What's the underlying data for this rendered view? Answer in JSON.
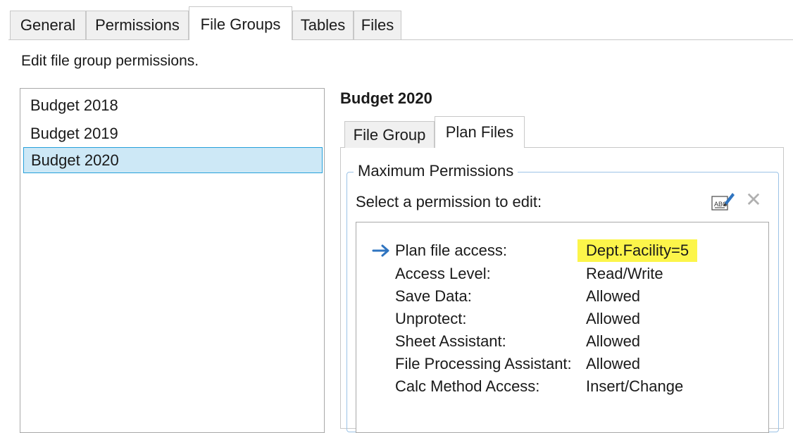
{
  "top_tabs": [
    "General",
    "Permissions",
    "File Groups",
    "Tables",
    "Files"
  ],
  "active_top_tab": "File Groups",
  "caption": "Edit file group permissions.",
  "file_groups": [
    "Budget 2018",
    "Budget 2019",
    "Budget 2020"
  ],
  "selected_group": "Budget 2020",
  "detail": {
    "title": "Budget 2020",
    "tabs": [
      "File Group",
      "Plan Files"
    ],
    "active_tab": "Plan Files",
    "legend": "Maximum Permissions",
    "select_label": "Select a permission to edit:",
    "icons": {
      "edit": "edit-text-icon",
      "clear": "close-icon"
    }
  },
  "permissions": [
    {
      "label": "Plan file access:",
      "value": "Dept.Facility=5",
      "selected": true
    },
    {
      "label": "Access Level:",
      "value": "Read/Write"
    },
    {
      "label": "Save Data:",
      "value": "Allowed"
    },
    {
      "label": "Unprotect:",
      "value": "Allowed"
    },
    {
      "label": "Sheet Assistant:",
      "value": "Allowed"
    },
    {
      "label": "File Processing Assistant:",
      "value": "Allowed"
    },
    {
      "label": "Calc Method Access:",
      "value": "Insert/Change"
    }
  ],
  "colors": {
    "selection": "#cde8f6",
    "selection_border": "#26a0da",
    "highlight": "#fcf54a",
    "arrow": "#2f74c0"
  }
}
